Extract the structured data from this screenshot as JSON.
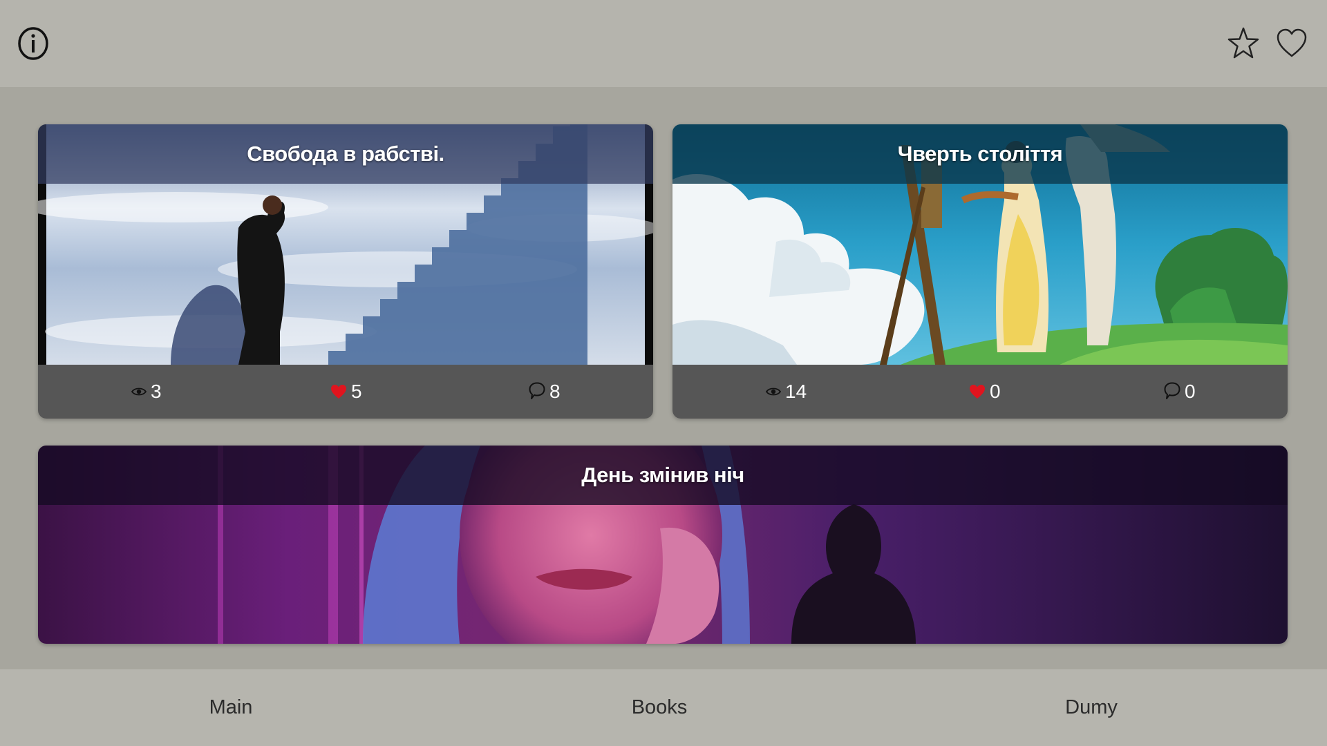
{
  "header": {
    "info_icon": "info-icon",
    "star_icon": "star-icon",
    "heart_icon": "heart-icon"
  },
  "cards": [
    {
      "title": "Свобода в рабстві.",
      "views": "3",
      "likes": "5",
      "comments": "8"
    },
    {
      "title": "Чверть століття",
      "views": "14",
      "likes": "0",
      "comments": "0"
    },
    {
      "title": "День змінив ніч"
    }
  ],
  "stat_icons": {
    "views": "eye-icon",
    "likes": "heart-filled-icon",
    "comments": "comment-icon"
  },
  "nav": {
    "items": [
      {
        "label": "Main"
      },
      {
        "label": "Books"
      },
      {
        "label": "Dumy"
      }
    ]
  },
  "colors": {
    "topbar": "#b5b4ad",
    "background": "#a7a69e",
    "stats_bar": "#565656",
    "like_red": "#e0141e",
    "text_white": "#ffffff"
  }
}
